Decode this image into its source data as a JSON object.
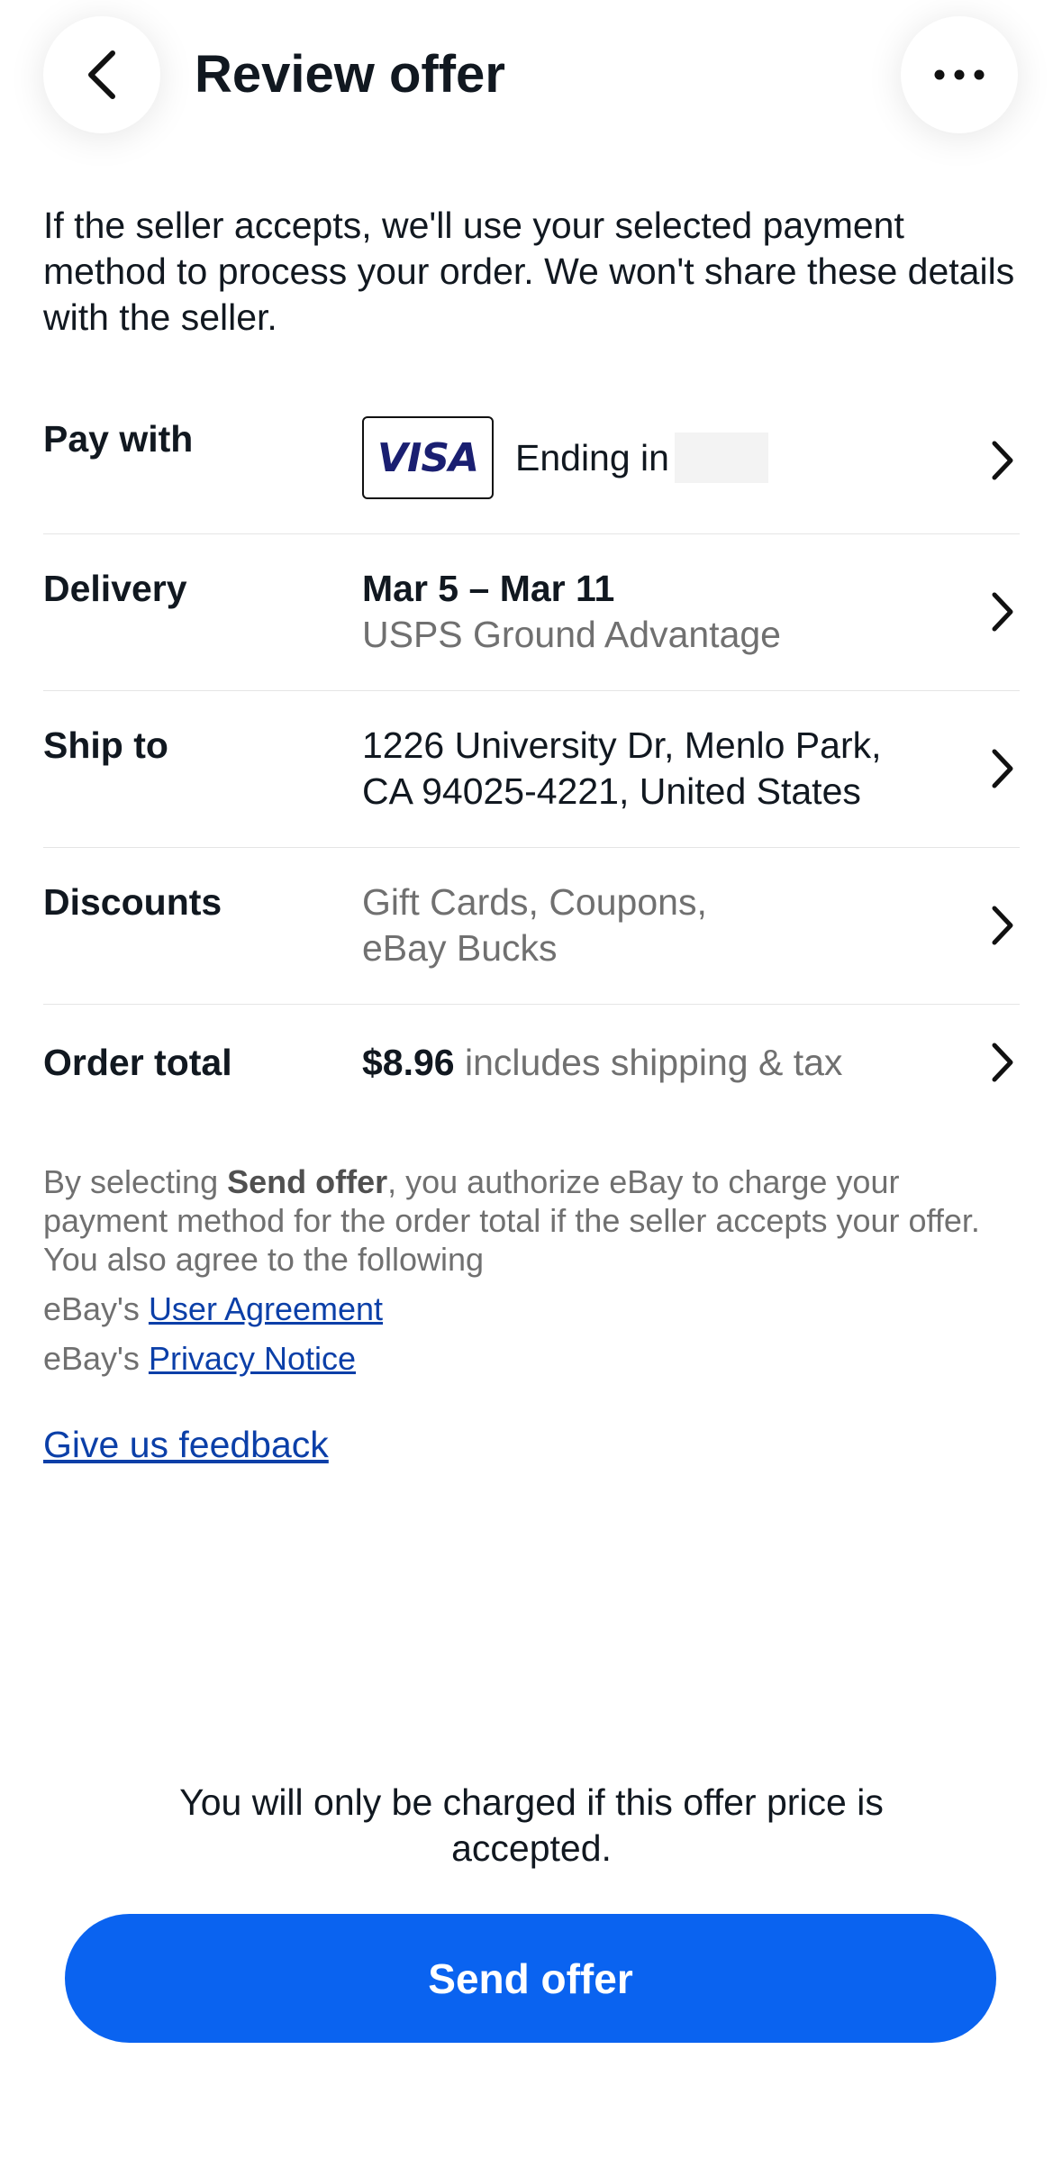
{
  "header": {
    "title": "Review offer",
    "back_icon": "chevron-left-icon",
    "more_icon": "more-horizontal-icon"
  },
  "intro_text": "If the seller accepts, we'll use your selected payment method to process your order. We won't share these details with the seller.",
  "rows": {
    "pay_with": {
      "label": "Pay with",
      "card_brand": "VISA",
      "value": "Ending in"
    },
    "delivery": {
      "label": "Delivery",
      "dates": "Mar 5 – Mar 11",
      "service": "USPS Ground Advantage"
    },
    "ship_to": {
      "label": "Ship to",
      "line1": "1226 University Dr, Menlo Park,",
      "line2": "CA 94025-4221, United States"
    },
    "discounts": {
      "label": "Discounts",
      "line1": "Gift Cards, Coupons,",
      "line2": "eBay Bucks"
    },
    "order_total": {
      "label": "Order total",
      "amount": "$8.96",
      "suffix": "includes shipping & tax"
    }
  },
  "legal": {
    "prefix": "By selecting ",
    "bold": "Send offer",
    "rest": ", you authorize eBay to charge your payment method for the order total if the seller accepts your offer. You also agree to the following",
    "line1_prefix": "eBay's ",
    "line1_link": "User Agreement",
    "line2_prefix": "eBay's ",
    "line2_link": "Privacy Notice"
  },
  "feedback_link": "Give us feedback",
  "charge_notice": "You will only be charged if this offer price is accepted.",
  "send_button": "Send offer",
  "colors": {
    "primary": "#0a63f0",
    "link": "#0b3fa8",
    "visa_blue": "#1a1f71"
  }
}
